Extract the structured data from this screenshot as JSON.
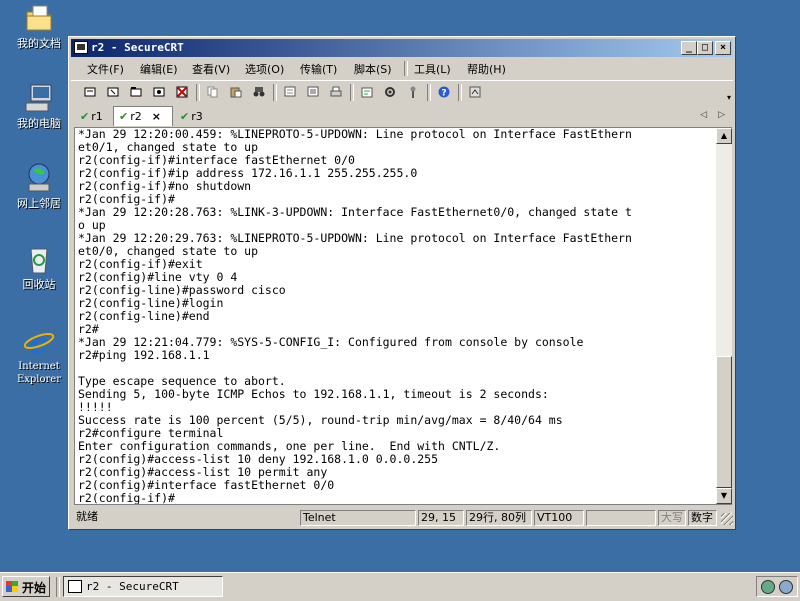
{
  "desktop": {
    "icons": [
      {
        "label": "我的文档",
        "icon": "folder-icon"
      },
      {
        "label": "我的电脑",
        "icon": "computer-icon"
      },
      {
        "label": "网上邻居",
        "icon": "network-icon"
      },
      {
        "label": "回收站",
        "icon": "recycle-bin-icon"
      },
      {
        "label": "Internet Explorer",
        "icon": "ie-icon"
      }
    ]
  },
  "window": {
    "title": "r2 - SecureCRT",
    "controls": {
      "minimize": "_",
      "maximize": "□",
      "close": "×"
    }
  },
  "menu": [
    "文件(F)",
    "编辑(E)",
    "查看(V)",
    "选项(O)",
    "传输(T)",
    "脚本(S)",
    "工具(L)",
    "帮助(H)"
  ],
  "tabs": [
    {
      "label": "r1",
      "active": false
    },
    {
      "label": "r2",
      "active": true,
      "close": "×"
    },
    {
      "label": "r3",
      "active": false
    }
  ],
  "terminal": {
    "lines": [
      "*Jan 29 12:20:00.459: %LINEPROTO-5-UPDOWN: Line protocol on Interface FastEthern",
      "et0/1, changed state to up",
      "r2(config-if)#interface fastEthernet 0/0",
      "r2(config-if)#ip address 172.16.1.1 255.255.255.0",
      "r2(config-if)#no shutdown",
      "r2(config-if)#",
      "*Jan 29 12:20:28.763: %LINK-3-UPDOWN: Interface FastEthernet0/0, changed state t",
      "o up",
      "*Jan 29 12:20:29.763: %LINEPROTO-5-UPDOWN: Line protocol on Interface FastEthern",
      "et0/0, changed state to up",
      "r2(config-if)#exit",
      "r2(config)#line vty 0 4",
      "r2(config-line)#password cisco",
      "r2(config-line)#login",
      "r2(config-line)#end",
      "r2#",
      "*Jan 29 12:21:04.779: %SYS-5-CONFIG_I: Configured from console by console",
      "r2#ping 192.168.1.1",
      "",
      "Type escape sequence to abort.",
      "Sending 5, 100-byte ICMP Echos to 192.168.1.1, timeout is 2 seconds:",
      "!!!!!",
      "Success rate is 100 percent (5/5), round-trip min/avg/max = 8/40/64 ms",
      "r2#configure terminal",
      "Enter configuration commands, one per line.  End with CNTL/Z.",
      "r2(config)#access-list 10 deny 192.168.1.0 0.0.0.255",
      "r2(config)#access-list 10 permit any",
      "r2(config)#interface fastEthernet 0/0",
      "r2(config-if)#"
    ]
  },
  "status": {
    "ready": "就绪",
    "protocol": "Telnet",
    "cursor": "29, 15",
    "size": "29行, 80列",
    "emulation": "VT100",
    "caps": "大写",
    "num": "数字"
  },
  "taskbar": {
    "start": "开始",
    "task": "r2 - SecureCRT"
  }
}
